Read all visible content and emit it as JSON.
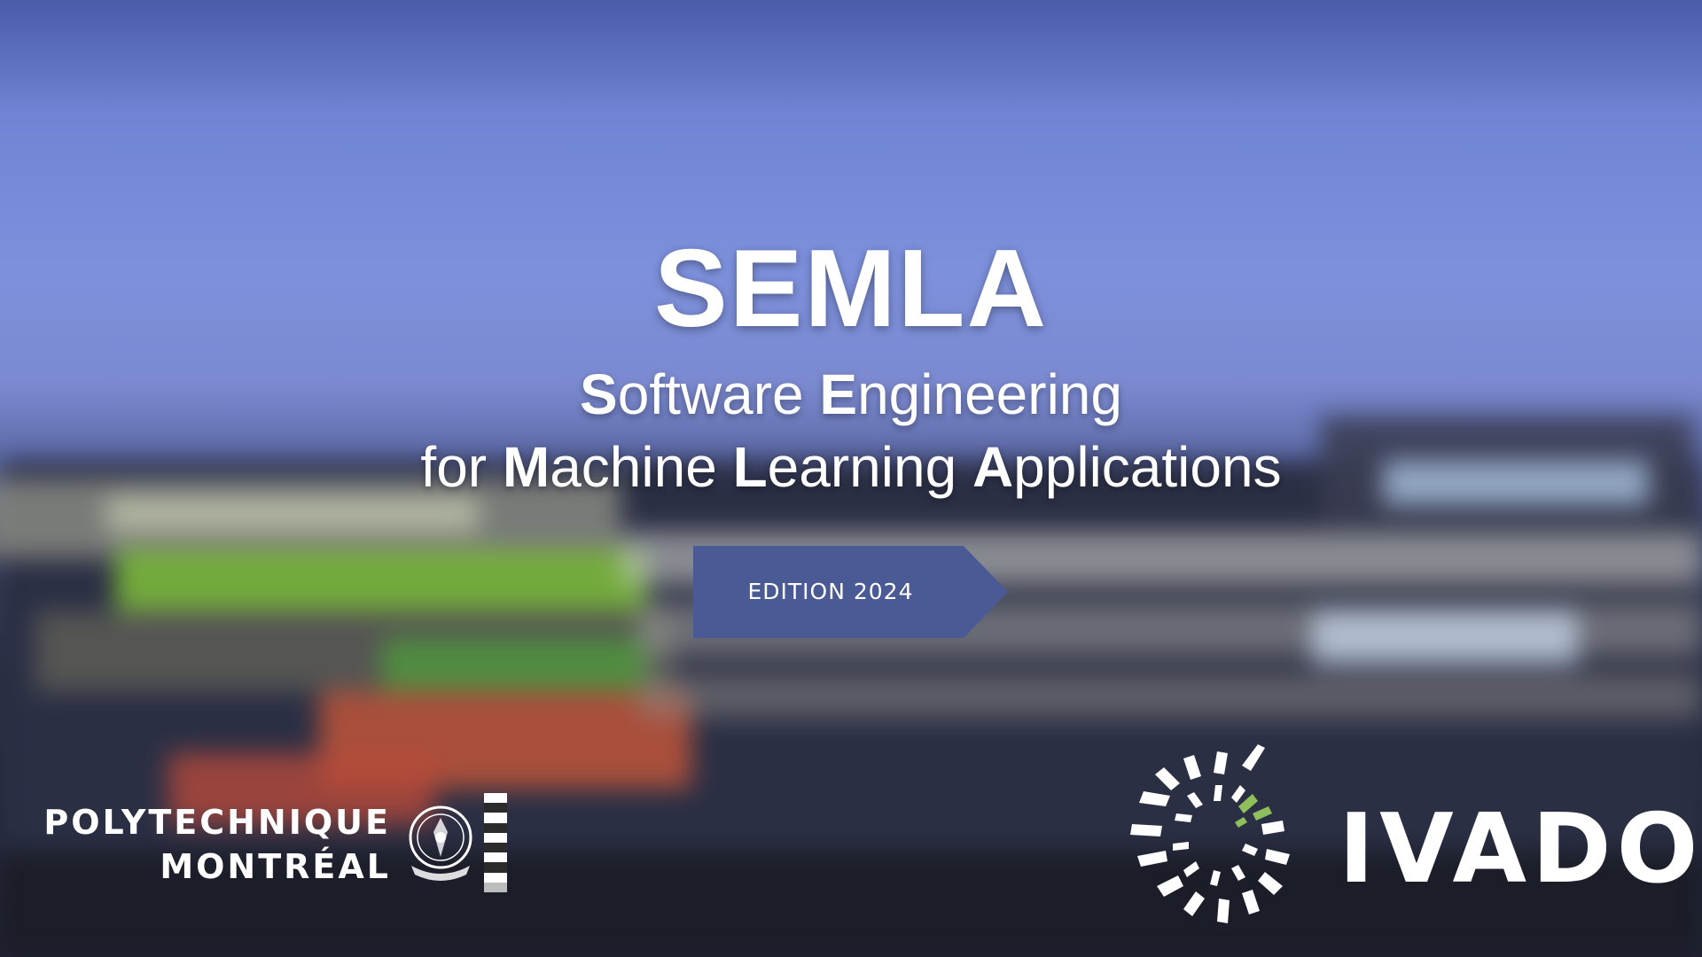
{
  "slide": {
    "title": "SEMLA",
    "subtitle_line1": {
      "parts": [
        {
          "text": "S",
          "bold": true
        },
        {
          "text": "oftware ",
          "bold": false
        },
        {
          "text": "E",
          "bold": true
        },
        {
          "text": "ngineering",
          "bold": false
        }
      ]
    },
    "subtitle_line2": {
      "parts": [
        {
          "text": "for ",
          "bold": false
        },
        {
          "text": "M",
          "bold": true
        },
        {
          "text": "achine ",
          "bold": false
        },
        {
          "text": "L",
          "bold": true
        },
        {
          "text": "earning ",
          "bold": false
        },
        {
          "text": "A",
          "bold": true
        },
        {
          "text": "pplications",
          "bold": false
        }
      ]
    },
    "edition_label": "EDITION 2024"
  },
  "logos": {
    "polytechnique": {
      "line1": "POLYTECHNIQUE",
      "line2": "MONTRÉAL",
      "seal_icon": "polytechnique-seal-icon"
    },
    "ivado": {
      "name": "IVADO",
      "mark_icon": "ivado-starburst-icon"
    }
  },
  "colors": {
    "edition_banner": "#4a5a94",
    "text": "#ffffff",
    "ivado_accent": "#8fbf5a"
  }
}
